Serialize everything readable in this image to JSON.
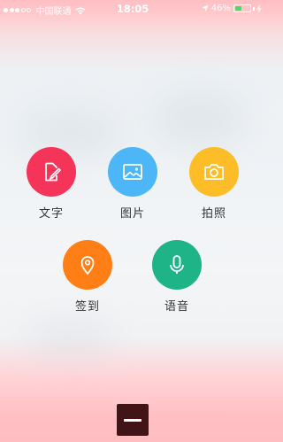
{
  "status_bar": {
    "carrier": "中国联通",
    "time": "18:05",
    "battery_percent": "46%",
    "battery_level": 0.46,
    "signal_filled": 3,
    "signal_total": 5
  },
  "actions": [
    {
      "id": "text",
      "label": "文字",
      "icon": "edit-icon",
      "color": "#f5345a"
    },
    {
      "id": "image",
      "label": "图片",
      "icon": "image-icon",
      "color": "#4cb6f7"
    },
    {
      "id": "photo",
      "label": "拍照",
      "icon": "camera-icon",
      "color": "#fdbd28"
    },
    {
      "id": "checkin",
      "label": "签到",
      "icon": "location-pin-icon",
      "color": "#ff7f16"
    },
    {
      "id": "voice",
      "label": "语音",
      "icon": "microphone-icon",
      "color": "#1fb487"
    }
  ],
  "close_button": {
    "icon": "minus-icon",
    "color": "#411418"
  }
}
